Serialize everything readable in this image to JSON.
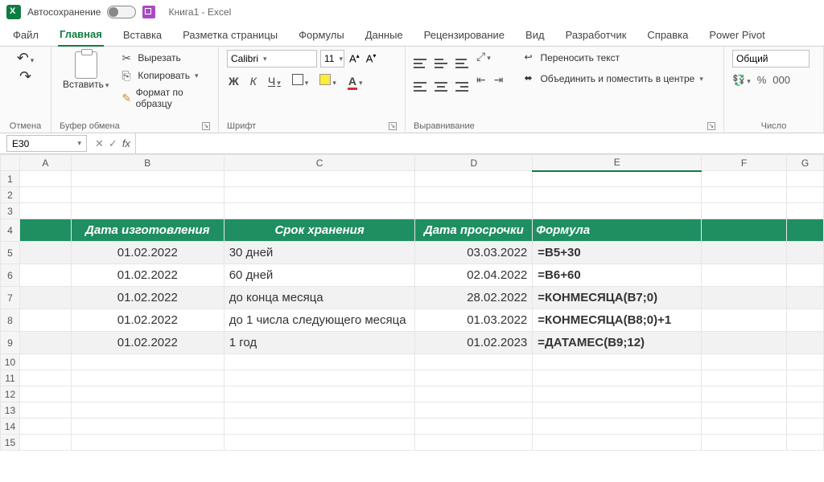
{
  "titlebar": {
    "autosave_label": "Автосохранение",
    "doc_title": "Книга1  -  Excel"
  },
  "tabs": {
    "file": "Файл",
    "home": "Главная",
    "insert": "Вставка",
    "layout": "Разметка страницы",
    "formulas": "Формулы",
    "data": "Данные",
    "review": "Рецензирование",
    "view": "Вид",
    "developer": "Разработчик",
    "help": "Справка",
    "powerpivot": "Power Pivot"
  },
  "ribbon": {
    "undo_group": "Отмена",
    "clipboard_group": "Буфер обмена",
    "font_group": "Шрифт",
    "align_group": "Выравнивание",
    "number_group": "Число",
    "paste": "Вставить",
    "cut": "Вырезать",
    "copy": "Копировать",
    "format_painter": "Формат по образцу",
    "font_name": "Calibri",
    "font_size": "11",
    "wrap": "Переносить текст",
    "merge": "Объединить и поместить в центре",
    "number_format": "Общий"
  },
  "fx": {
    "namebox": "E30",
    "formula": ""
  },
  "columns": [
    "A",
    "B",
    "C",
    "D",
    "E",
    "F",
    "G"
  ],
  "table": {
    "header": {
      "b": "Дата изготовления",
      "c": "Срок хранения",
      "d": "Дата просрочки",
      "e": "Формула"
    },
    "rows": [
      {
        "b": "01.02.2022",
        "c": "30 дней",
        "d": "03.03.2022",
        "e": "=B5+30"
      },
      {
        "b": "01.02.2022",
        "c": "60 дней",
        "d": "02.04.2022",
        "e": "=B6+60"
      },
      {
        "b": "01.02.2022",
        "c": "до конца месяца",
        "d": "28.02.2022",
        "e": "=КОНМЕСЯЦА(B7;0)"
      },
      {
        "b": "01.02.2022",
        "c": "до 1 числа следующего месяца",
        "d": "01.03.2022",
        "e": "=КОНМЕСЯЦА(B8;0)+1"
      },
      {
        "b": "01.02.2022",
        "c": "1 год",
        "d": "01.02.2023",
        "e": "=ДАТАМЕС(B9;12)"
      }
    ]
  },
  "selected_cell": "E30"
}
